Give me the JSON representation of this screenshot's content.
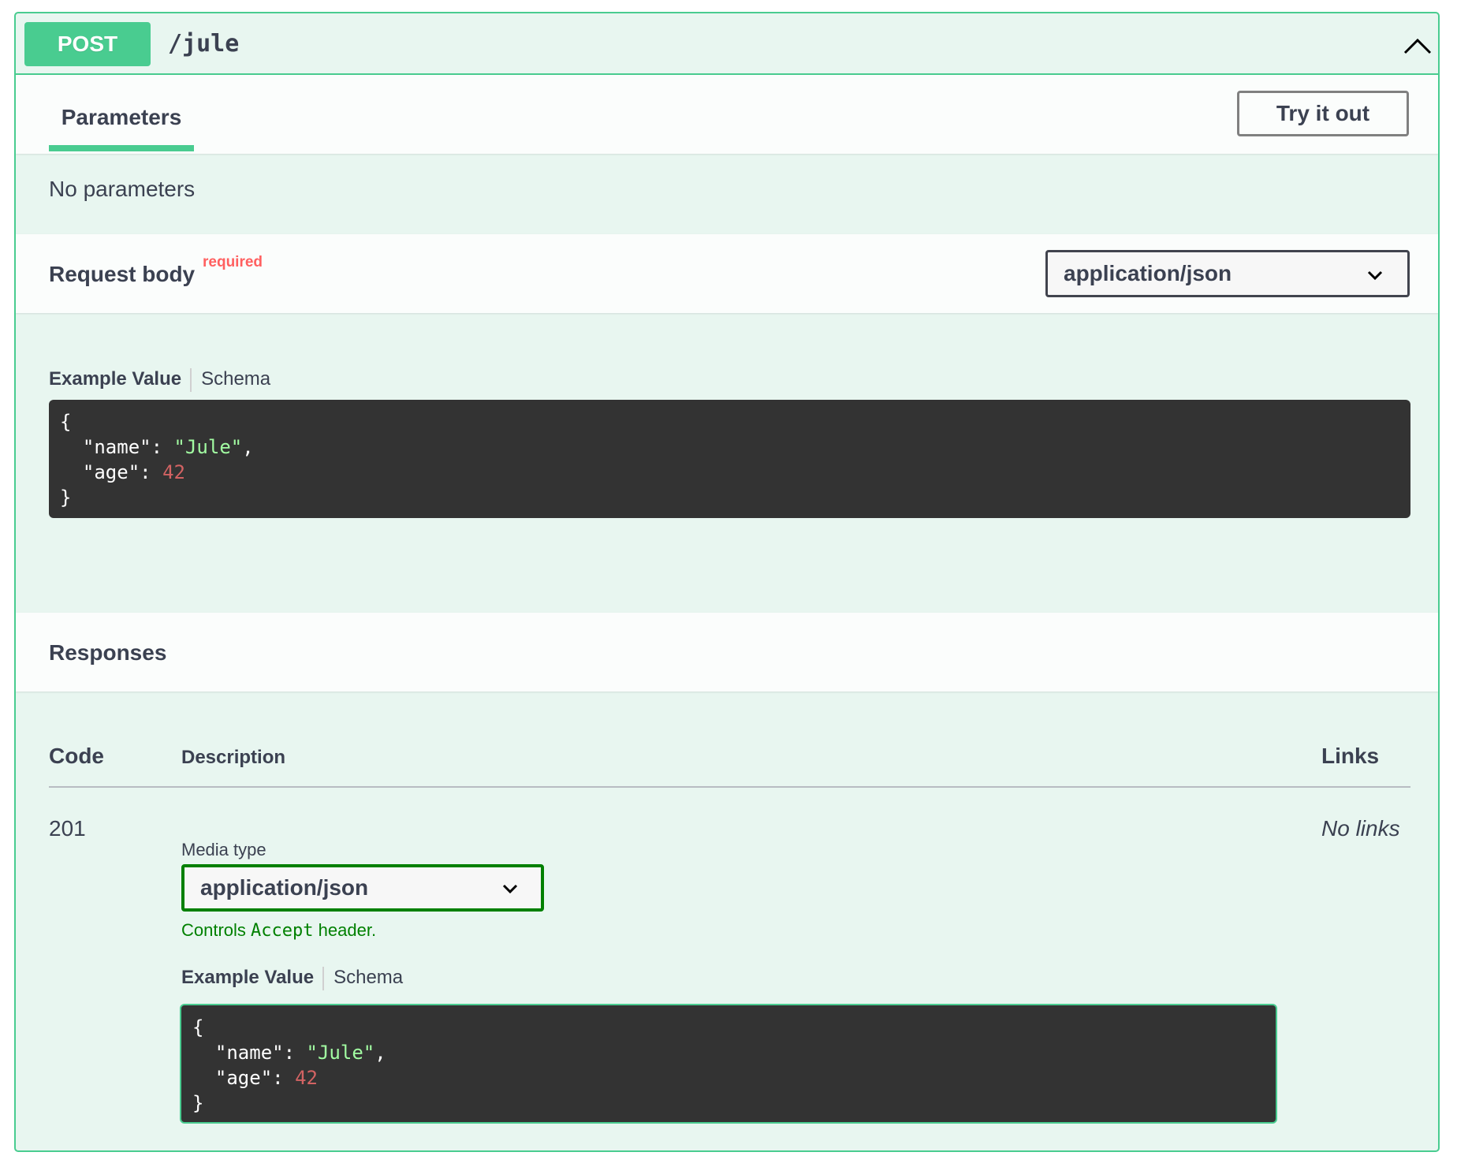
{
  "operation": {
    "method": "POST",
    "path": "/jule"
  },
  "parameters": {
    "tab_label": "Parameters",
    "try_button": "Try it out",
    "empty_text": "No parameters"
  },
  "request_body": {
    "title": "Request body",
    "required_label": "required",
    "content_type": "application/json",
    "example_tab": "Example Value",
    "schema_tab": "Schema",
    "example": {
      "open": "{",
      "k_name": "\"name\"",
      "v_name": "\"Jule\"",
      "k_age": "\"age\"",
      "v_age": "42",
      "close": "}"
    }
  },
  "responses": {
    "title": "Responses",
    "columns": {
      "code": "Code",
      "description": "Description",
      "links": "Links"
    },
    "rows": [
      {
        "code": "201",
        "links": "No links",
        "media_type_label": "Media type",
        "media_type": "application/json",
        "hint_prefix": "Controls",
        "hint_code": "Accept",
        "hint_suffix": "header.",
        "example_tab": "Example Value",
        "schema_tab": "Schema",
        "example": {
          "open": "{",
          "k_name": "\"name\"",
          "v_name": "\"Jule\"",
          "k_age": "\"age\"",
          "v_age": "42",
          "close": "}"
        }
      }
    ]
  },
  "colors": {
    "accent": "#49cc90",
    "panel_bg": "#e8f6f0",
    "code_bg": "#333333",
    "string": "#a2fca2",
    "number": "#d36363",
    "required": "#ff6060",
    "success": "#008000"
  },
  "icons": {
    "collapse": "chevron-up-icon",
    "select": "chevron-down-icon"
  }
}
